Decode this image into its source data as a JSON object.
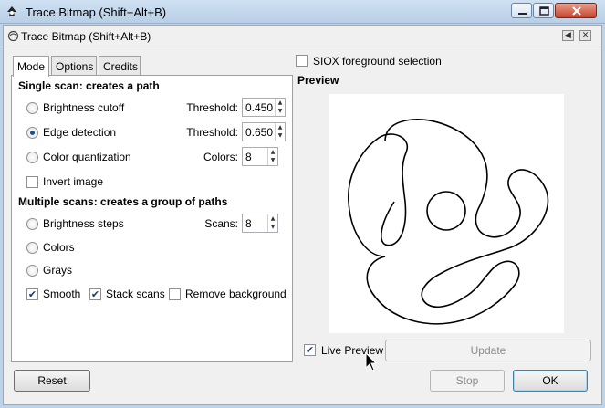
{
  "window": {
    "title": "Trace Bitmap (Shift+Alt+B)"
  },
  "dock": {
    "title": "Trace Bitmap (Shift+Alt+B)"
  },
  "tabs": [
    {
      "label": "Mode",
      "active": true
    },
    {
      "label": "Options",
      "active": false
    },
    {
      "label": "Credits",
      "active": false
    }
  ],
  "single_scan": {
    "title": "Single scan: creates a path",
    "brightness": {
      "label": "Brightness cutoff",
      "selected": false,
      "param_label": "Threshold:",
      "value": "0.450"
    },
    "edge": {
      "label": "Edge detection",
      "selected": true,
      "param_label": "Threshold:",
      "value": "0.650"
    },
    "color": {
      "label": "Color quantization",
      "selected": false,
      "param_label": "Colors:",
      "value": "8"
    },
    "invert": {
      "label": "Invert image",
      "checked": false
    }
  },
  "multi_scan": {
    "title": "Multiple scans: creates a group of paths",
    "brightness_steps": {
      "label": "Brightness steps",
      "selected": false,
      "param_label": "Scans:",
      "value": "8"
    },
    "colors": {
      "label": "Colors",
      "selected": false
    },
    "grays": {
      "label": "Grays",
      "selected": false
    },
    "smooth": {
      "label": "Smooth",
      "checked": true
    },
    "stack": {
      "label": "Stack scans",
      "checked": true
    },
    "remove_bg": {
      "label": "Remove background",
      "checked": false
    }
  },
  "siox": {
    "label": "SIOX foreground selection",
    "checked": false
  },
  "preview": {
    "title": "Preview",
    "live_label": "Live Preview",
    "live_checked": true,
    "update_label": "Update"
  },
  "buttons": {
    "reset": "Reset",
    "stop": "Stop",
    "ok": "OK"
  },
  "colors": {
    "accent": "#1b4f91",
    "titlebar": "#bcd3ea",
    "panel": "#f0f0f0"
  }
}
